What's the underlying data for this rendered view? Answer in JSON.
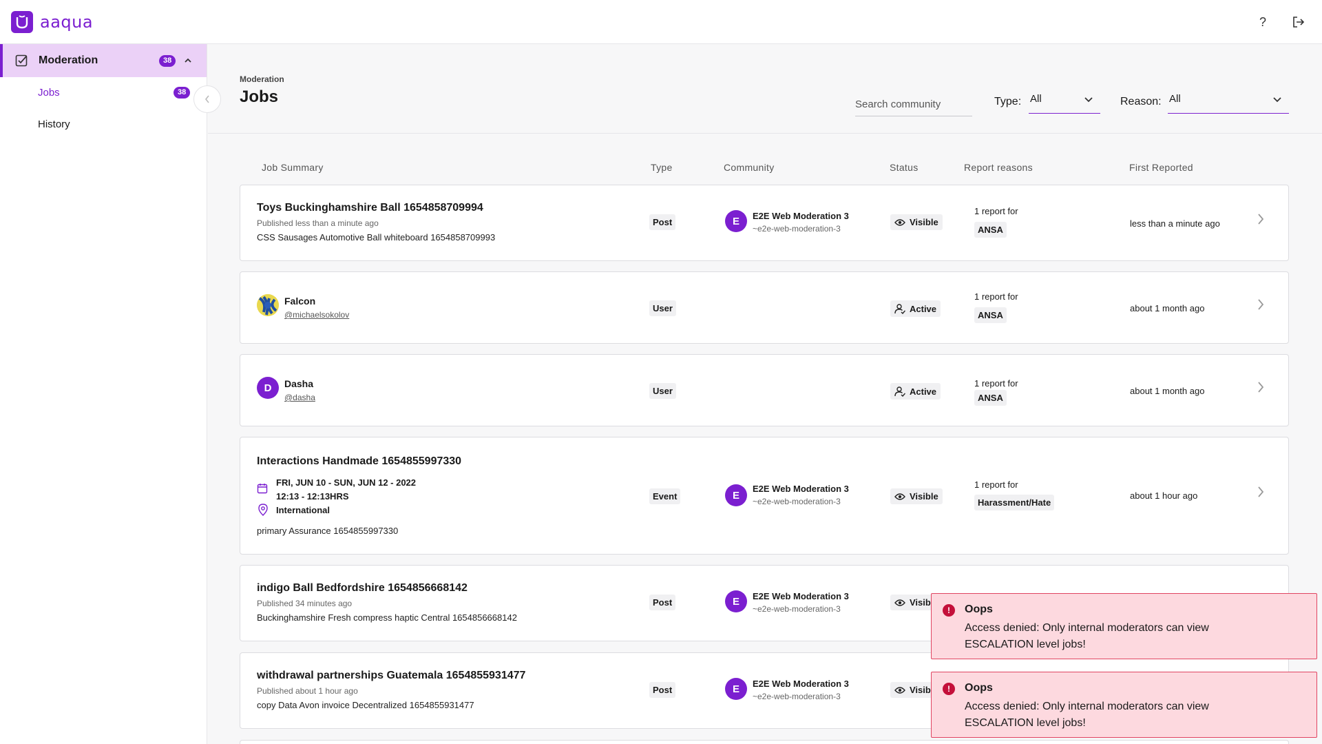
{
  "app": {
    "logo_text": "aaqua",
    "help_icon": "help-icon",
    "logout_icon": "logout-icon",
    "accent": "#7b1fd0"
  },
  "sidebar": {
    "section_label": "Moderation",
    "section_count": "38",
    "items": [
      {
        "label": "Jobs",
        "count": "38",
        "active": true
      },
      {
        "label": "History"
      }
    ]
  },
  "header": {
    "breadcrumb": "Moderation",
    "title": "Jobs",
    "search_placeholder": "Search community",
    "type_label": "Type:",
    "type_value": "All",
    "reason_label": "Reason:",
    "reason_value": "All"
  },
  "table": {
    "columns": [
      "Job Summary",
      "Type",
      "Community",
      "Status",
      "Report reasons",
      "First Reported"
    ],
    "rows": [
      {
        "title": "Toys Buckinghamshire Ball 1654858709994",
        "published": "Published less than a minute ago",
        "description": "CSS Sausages Automotive Ball whiteboard 1654858709993",
        "type": "Post",
        "community_initial": "E",
        "community_name": "E2E Web Moderation 3",
        "community_handle": "~e2e-web-moderation-3",
        "status": "Visible",
        "report_count": "1 report for",
        "reason": "ANSA",
        "first_reported": "less than a minute ago"
      },
      {
        "user_name": "Falcon",
        "user_handle": "@michaelsokolov",
        "type": "User",
        "status": "Active",
        "report_count": "1 report for",
        "reason": "ANSA",
        "first_reported": "about 1 month ago"
      },
      {
        "user_initial": "D",
        "user_name": "Dasha",
        "user_handle": "@dasha",
        "type": "User",
        "status": "Active",
        "report_count": "1 report for",
        "reason": "ANSA",
        "first_reported": "about 1 month ago"
      },
      {
        "title": "Interactions Handmade 1654855997330",
        "event_dates": "FRI, JUN 10 - SUN, JUN 12 - 2022",
        "event_times": "12:13 - 12:13HRS",
        "event_location": "International",
        "description": "primary Assurance 1654855997330",
        "type": "Event",
        "community_initial": "E",
        "community_name": "E2E Web Moderation 3",
        "community_handle": "~e2e-web-moderation-3",
        "status": "Visible",
        "report_count": "1 report for",
        "reason": "Harassment/Hate",
        "first_reported": "about 1 hour ago"
      },
      {
        "title": "indigo Ball Bedfordshire 1654856668142",
        "published": "Published 34 minutes ago",
        "description": "Buckinghamshire Fresh compress haptic Central 1654856668142",
        "type": "Post",
        "community_initial": "E",
        "community_name": "E2E Web Moderation 3",
        "community_handle": "~e2e-web-moderation-3",
        "status": "Visib"
      },
      {
        "title": "withdrawal partnerships Guatemala 1654855931477",
        "published": "Published about 1 hour ago",
        "description": "copy Data Avon invoice Decentralized 1654855931477",
        "type": "Post",
        "community_initial": "E",
        "community_name": "E2E Web Moderation 3",
        "community_handle": "~e2e-web-moderation-3",
        "status": "Visib"
      }
    ]
  },
  "toasts": [
    {
      "title": "Oops",
      "message": "Access denied: Only internal moderators can view ESCALATION level jobs!"
    },
    {
      "title": "Oops",
      "message": "Access denied: Only internal moderators can view ESCALATION level jobs!"
    }
  ]
}
